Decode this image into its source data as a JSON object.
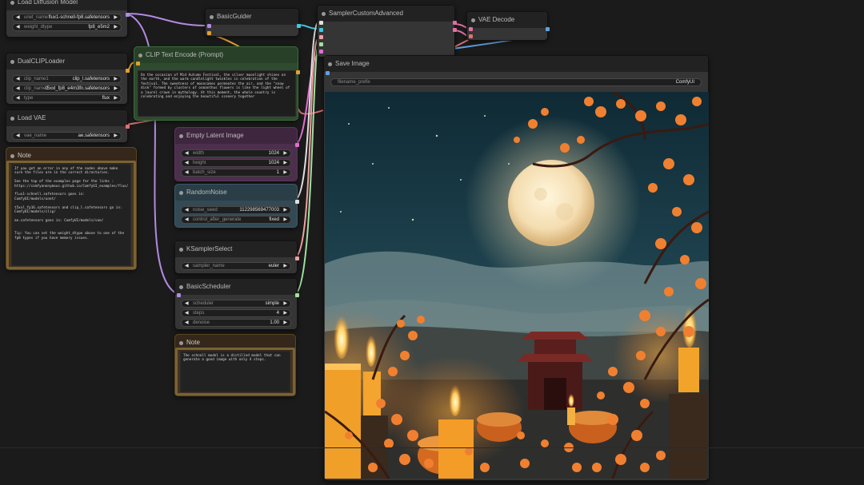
{
  "colors": {
    "canvas_bg": "#1b1b1b",
    "node_bg": "#353535",
    "clip_node_bg": "#2f4a2f",
    "latent_node_bg": "#4c2f4c",
    "noise_node_bg": "#334a55",
    "note_node_bg": "#433322",
    "wire_purple": "#b28ae0",
    "wire_yellow": "#e0a030",
    "wire_cyan": "#40c8e0",
    "wire_pink": "#e070a0",
    "wire_green": "#a0e0a0",
    "wire_blue": "#60a0e0"
  },
  "nodes": {
    "load_diffusion": {
      "title": "Load Diffusion Model",
      "widgets": [
        {
          "label": "unet_name",
          "value": "flux1-schnell-fp8.safetensors"
        },
        {
          "label": "weight_dtype",
          "value": "fp8_e5m2"
        }
      ]
    },
    "dual_clip": {
      "title": "DualCLIPLoader",
      "widgets": [
        {
          "label": "clip_name1",
          "value": "clip_l.safetensors"
        },
        {
          "label": "clip_name2",
          "value": "t5xxl_fp8_e4m3fn.safetensors"
        },
        {
          "label": "type",
          "value": "flux"
        }
      ]
    },
    "load_vae": {
      "title": "Load VAE",
      "widgets": [
        {
          "label": "vae_name",
          "value": "ae.safetensors"
        }
      ]
    },
    "note1": {
      "title": "Note",
      "text": "If you get an error in any of the nodes above make sure the files are in the correct directories.\n\nSee the top of the examples page for the links : https://comfyanonymous.github.io/ComfyUI_examples/flux/\n\nflux1-schnell.safetensors goes in: ComfyUI/models/unet/\n\nt5xxl_fp16.safetensors and clip_l.safetensors go in: ComfyUI/models/clip/\n\nae.safetensors goes in: ComfyUI/models/vae/\n\n\nTip: You can set the weight_dtype above to one of the fp8 types if you have memory issues."
    },
    "clip_text": {
      "title": "CLIP Text Encode (Prompt)",
      "text": "On the occasion of Mid Autumn Festival, the silver moonlight shines on the earth, and the warm candlelight twinkles in celebration of the festival. The sweetness of mooncakes permeates the air, and the \"snow disk\" formed by clusters of osmanthus flowers is like the light wheel of a laurel crown in mythology. At this moment, the whole country is celebrating and enjoying the beautiful scenery together"
    },
    "basic_guider": {
      "title": "BasicGuider"
    },
    "sampler_custom": {
      "title": "SamplerCustomAdvanced"
    },
    "vae_decode": {
      "title": "VAE Decode"
    },
    "empty_latent": {
      "title": "Empty Latent Image",
      "widgets": [
        {
          "label": "width",
          "value": "1024"
        },
        {
          "label": "height",
          "value": "1024"
        },
        {
          "label": "batch_size",
          "value": "1"
        }
      ]
    },
    "random_noise": {
      "title": "RandomNoise",
      "widgets": [
        {
          "label": "noise_seed",
          "value": "112298569477003"
        },
        {
          "label": "control_after_generate",
          "value": "fixed"
        }
      ]
    },
    "ksampler_select": {
      "title": "KSamplerSelect",
      "widgets": [
        {
          "label": "sampler_name",
          "value": "euler"
        }
      ]
    },
    "basic_scheduler": {
      "title": "BasicScheduler",
      "widgets": [
        {
          "label": "scheduler",
          "value": "simple"
        },
        {
          "label": "steps",
          "value": "4"
        },
        {
          "label": "denoise",
          "value": "1.00"
        }
      ]
    },
    "note2": {
      "title": "Note",
      "text": "The schnell model is a distilled model that can generate a good image with only 4 steps."
    },
    "save_image": {
      "title": "Save Image",
      "widgets": [
        {
          "label": "filename_prefix",
          "value": "ComfyUI"
        }
      ]
    }
  }
}
